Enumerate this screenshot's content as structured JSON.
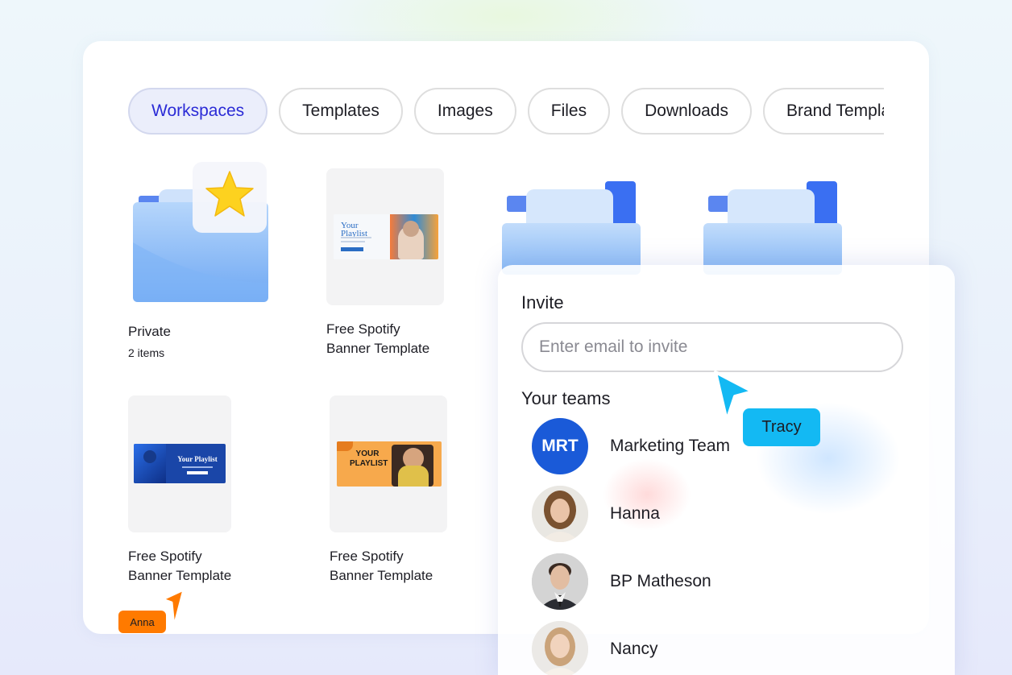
{
  "tabs": [
    {
      "label": "Workspaces",
      "active": true
    },
    {
      "label": "Templates",
      "active": false
    },
    {
      "label": "Images",
      "active": false
    },
    {
      "label": "Files",
      "active": false
    },
    {
      "label": "Downloads",
      "active": false
    },
    {
      "label": "Brand Templates",
      "active": false
    }
  ],
  "items": [
    {
      "title": "Private",
      "subtitle": "2 items",
      "icon": "starred-folder-icon"
    },
    {
      "title_line1": "Free Spotify",
      "title_line2": "Banner Template",
      "banner_text": "Your Playlist"
    },
    {
      "title_line1": "Free Spotify",
      "title_line2": "Banner Template",
      "banner_text": "Your Playlist"
    },
    {
      "title_line1": "Free Spotify",
      "title_line2": "Banner Template",
      "banner_text_line1": "YOUR",
      "banner_text_line2": "PLAYLIST"
    }
  ],
  "invite": {
    "label": "Invite",
    "placeholder": "Enter email to invite",
    "teams_label": "Your teams",
    "members": [
      {
        "name": "Marketing Team",
        "initials": "MRT"
      },
      {
        "name": "Hanna"
      },
      {
        "name": "BP Matheson"
      },
      {
        "name": "Nancy"
      }
    ]
  },
  "cursors": [
    {
      "label": "Tracy",
      "color": "#13b9f3"
    },
    {
      "label": "Anna",
      "color": "#ff7a00"
    }
  ],
  "colors": {
    "accent": "#2b2bd6",
    "folder": "#7fb2f5",
    "mrt_avatar": "#1a5ad8"
  }
}
